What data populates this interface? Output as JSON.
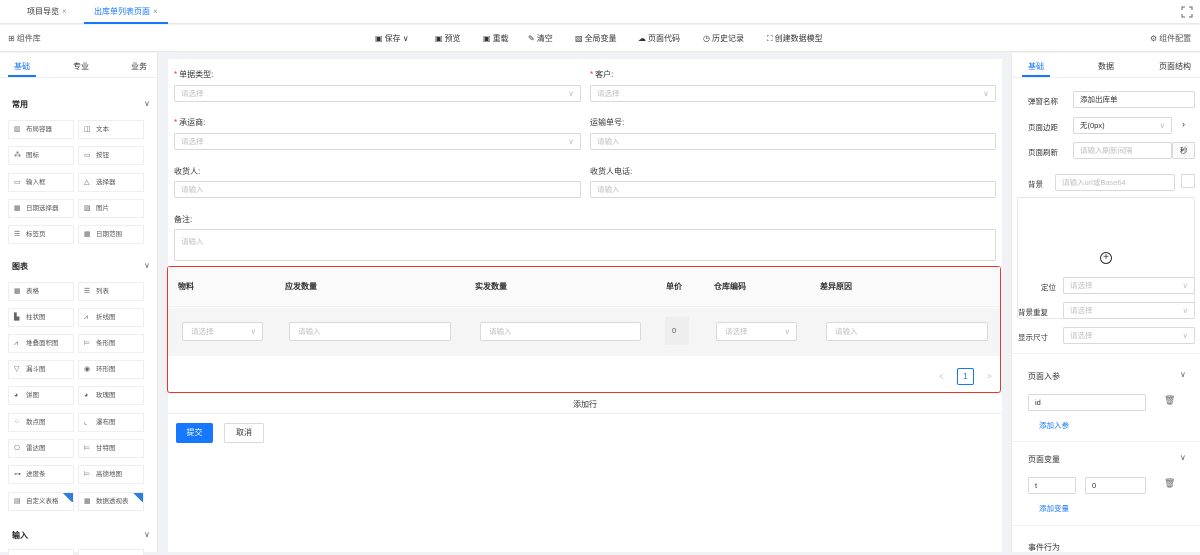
{
  "tabs": [
    {
      "label": "项目导览",
      "close": "×"
    },
    {
      "label": "出库单列表页面",
      "close": "×"
    }
  ],
  "toolbar": {
    "component_lib": "组件库",
    "save": "保存",
    "save_arrow": "∨",
    "preview": "预览",
    "reload": "重载",
    "clear": "清空",
    "global_vars": "全局变量",
    "page_code": "页面代码",
    "history": "历史记录",
    "create_model": "创建数据模型",
    "component_config": "组件配置"
  },
  "left": {
    "tabs": [
      "基础",
      "专业",
      "业务"
    ],
    "sections": [
      {
        "title": "常用",
        "items": [
          "布局容器",
          "文本",
          "图标",
          "按钮",
          "输入框",
          "选择器",
          "日期选择器",
          "图片",
          "标签页",
          "日期范围"
        ]
      },
      {
        "title": "图表",
        "items": [
          "表格",
          "列表",
          "柱状图",
          "折线图",
          "堆叠面积图",
          "条形图",
          "漏斗图",
          "环形图",
          "饼图",
          "玫瑰图",
          "散点图",
          "瀑布图",
          "雷达图",
          "甘特图",
          "进度条",
          "高德地图",
          "自定义表格",
          "数据透视表"
        ]
      },
      {
        "title": "输入",
        "items": []
      }
    ]
  },
  "form": {
    "doc_type": {
      "label": "单据类型:",
      "placeholder": "请选择"
    },
    "customer": {
      "label": "客户:",
      "placeholder": "请选择"
    },
    "carrier": {
      "label": "承运商:",
      "placeholder": "请选择"
    },
    "tracking": {
      "label": "运输单号:",
      "placeholder": "请输入"
    },
    "receiver": {
      "label": "收货人:",
      "placeholder": "请输入"
    },
    "receiver_phone": {
      "label": "收货人电话:",
      "placeholder": "请输入"
    },
    "remark": {
      "label": "备注:",
      "placeholder": "请输入"
    }
  },
  "table": {
    "columns": [
      "物料",
      "应发数量",
      "实发数量",
      "单价",
      "仓库编码",
      "差异原因"
    ],
    "row": {
      "material": "请选择",
      "qty_due": "请输入",
      "qty_actual": "请输入",
      "unit_price": "0",
      "warehouse": "请选择",
      "reason": "请输入"
    },
    "pager": {
      "prev": "<",
      "current": "1",
      "next": ">"
    }
  },
  "add_row": "添加行",
  "submit": "提交",
  "cancel": "取消",
  "right": {
    "tabs": [
      "基础",
      "数据",
      "页面结构"
    ],
    "popup_name_label": "弹窗名称",
    "popup_name_value": "添加出库单",
    "page_margin_label": "页面边距",
    "page_margin_value": "无(0px)",
    "page_refresh_label": "页面刷新",
    "page_refresh_placeholder": "请输入刷新间隔",
    "page_refresh_unit": "秒",
    "bg_label": "背景",
    "bg_placeholder": "请输入url或Base64",
    "position_label": "定位",
    "position_placeholder": "请选择",
    "bg_repeat_label": "背景重复",
    "bg_repeat_placeholder": "请选择",
    "display_size_label": "显示尺寸",
    "display_size_placeholder": "请选择",
    "page_params_title": "页面入参",
    "param_value": "id",
    "add_param": "添加入参",
    "page_vars_title": "页面变量",
    "var_name": "t",
    "var_value": "0",
    "add_var": "添加变量",
    "events_title": "事件行为"
  }
}
